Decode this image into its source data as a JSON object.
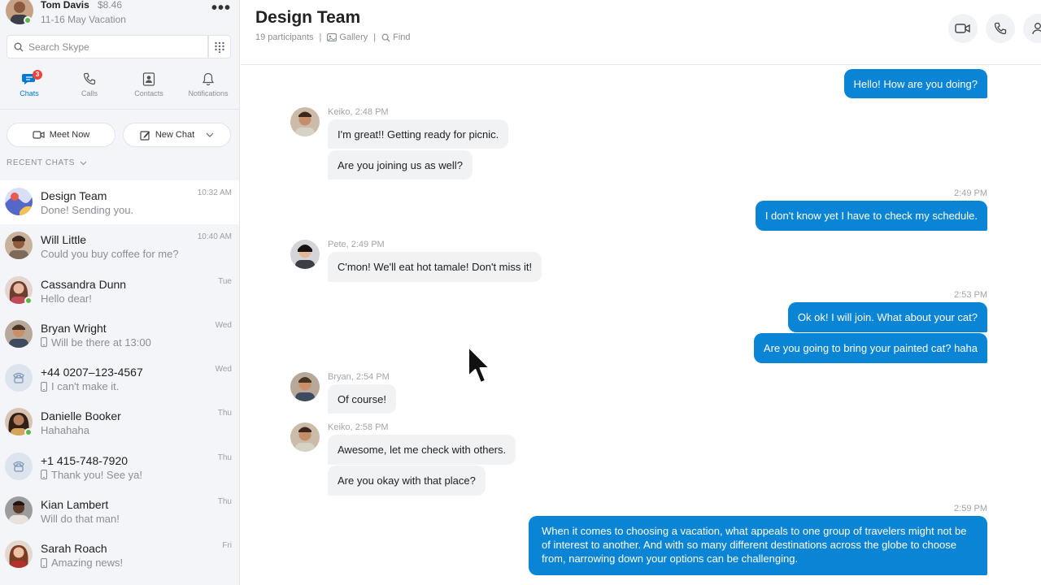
{
  "profile": {
    "name": "Tom Davis",
    "credit": "$8.46",
    "mood": "11-16 May Vacation"
  },
  "search": {
    "placeholder": "Search Skype"
  },
  "nav": [
    {
      "label": "Chats",
      "badge": "3"
    },
    {
      "label": "Calls"
    },
    {
      "label": "Contacts"
    },
    {
      "label": "Notifications"
    }
  ],
  "actions": {
    "meet_now": "Meet Now",
    "new_chat": "New Chat"
  },
  "recent_label": "RECENT CHATS",
  "chats": [
    {
      "name": "Design Team",
      "message": "Done! Sending you.",
      "time": "10:32 AM"
    },
    {
      "name": "Will Little",
      "message": "Could you buy coffee for me?",
      "time": "10:40 AM"
    },
    {
      "name": "Cassandra Dunn",
      "message": "Hello dear!",
      "time": "Tue"
    },
    {
      "name": "Bryan Wright",
      "message": "Will be there at 13:00",
      "time": "Wed"
    },
    {
      "name": "+44 0207–123-4567",
      "message": "I can't make it.",
      "time": "Wed"
    },
    {
      "name": "Danielle Booker",
      "message": "Hahahaha",
      "time": "Thu"
    },
    {
      "name": "+1 415-748-7920",
      "message": "Thank you! See ya!",
      "time": "Thu"
    },
    {
      "name": "Kian Lambert",
      "message": "Will do that man!",
      "time": "Thu"
    },
    {
      "name": "Sarah Roach",
      "message": "Amazing news!",
      "time": "Fri"
    }
  ],
  "conversation": {
    "title": "Design Team",
    "participants": "19 participants",
    "gallery": "Gallery",
    "find": "Find"
  },
  "messages": {
    "m1": "Hello! How are you doing?",
    "keiko1_stamp": "Keiko, 2:48 PM",
    "m2": "I'm great!! Getting ready for picnic.",
    "m3": "Are you joining us as well?",
    "t249": "2:49 PM",
    "m4": "I don't know yet I have to check my schedule.",
    "pete_stamp": "Pete, 2:49 PM",
    "m5": "C'mon! We'll eat hot tamale! Don't miss it!",
    "t253": "2:53 PM",
    "m6": "Ok ok! I will join. What about your cat?",
    "m7": "Are you going to bring your painted cat? haha",
    "bryan_stamp": "Bryan, 2:54 PM",
    "m8": "Of course!",
    "keiko2_stamp": "Keiko, 2:58 PM",
    "m9": "Awesome, let me check with others.",
    "m10": "Are you okay with that place?",
    "t259": "2:59 PM",
    "m11": "When it comes to choosing a vacation, what appeals to one group of travelers might not be of interest to another. And with so many different destinations across the globe to choose from, narrowing down your options can be challenging."
  },
  "colors": {
    "accent": "#0078d4",
    "outgoing_bubble": "#0a84d4",
    "presence": "#57b947",
    "badge": "#e8453c"
  }
}
